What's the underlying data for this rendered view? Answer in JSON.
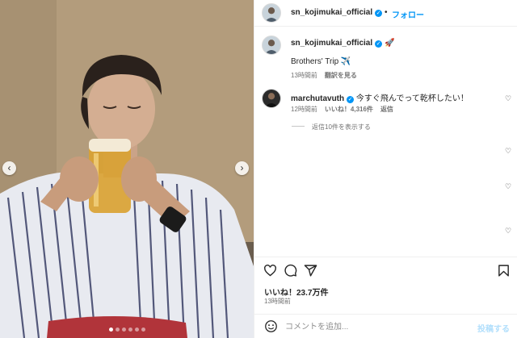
{
  "post": {
    "username": "sn_kojimukai_official",
    "follow_label": "フォロー",
    "separator": "•",
    "caption_text": "Brothers' Trip ✈️",
    "caption_badge": "🚀",
    "caption_time": "13時間前",
    "caption_translate": "翻訳を見る",
    "likes": "いいね！23.7万件",
    "time": "13時間前",
    "comment_placeholder": "コメントを追加...",
    "post_label": "投稿する",
    "carousel_dots": 6
  },
  "comments": [
    {
      "username": "marchutavuth",
      "text": "今すぐ飛んでって乾杯したい！",
      "time": "12時間前",
      "likes": "いいね！4,316件",
      "reply_label": "返信",
      "view_replies": "返信10件を表示する"
    }
  ],
  "icons": {
    "prev": "chevron-left-icon",
    "next": "chevron-right-icon",
    "like": "heart-icon",
    "comment": "comment-icon",
    "share": "share-icon",
    "save": "bookmark-icon",
    "emoji": "emoji-icon",
    "verified": "verified-badge-icon"
  },
  "colors": {
    "accent": "#0095f6",
    "post_disabled": "#b2dffc",
    "muted": "#737373"
  }
}
